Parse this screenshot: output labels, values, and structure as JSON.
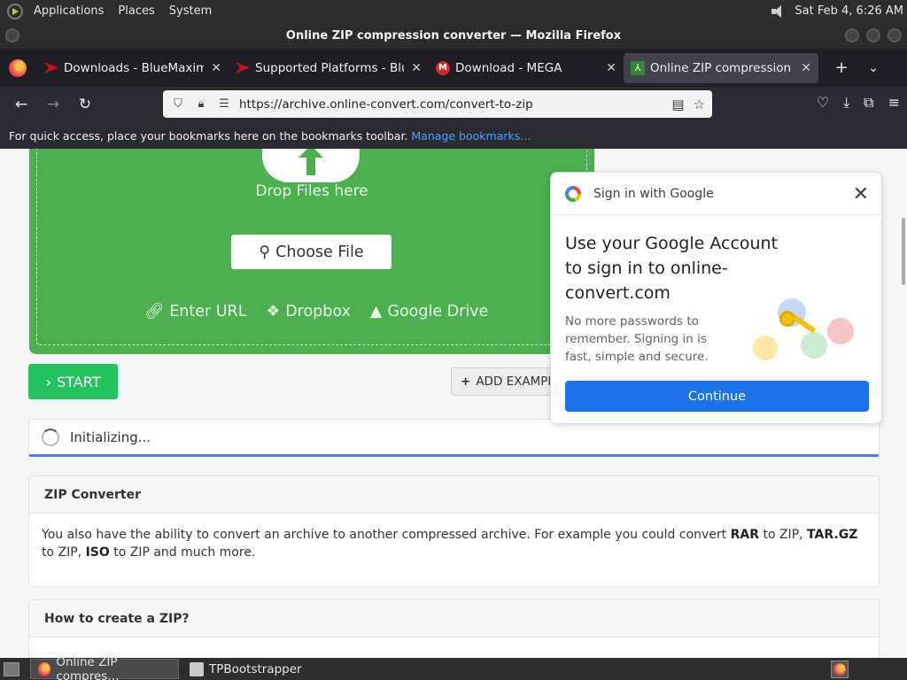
{
  "panel": {
    "menu": [
      "Applications",
      "Places",
      "System"
    ],
    "clock": "Sat Feb  4,  6:26 AM"
  },
  "window": {
    "title": "Online ZIP compression converter — Mozilla Firefox"
  },
  "tabs": [
    {
      "label": "Downloads - BlueMaxima's F",
      "icon": "flashpoint-icon",
      "active": false
    },
    {
      "label": "Supported Platforms - BlueM",
      "icon": "flashpoint-icon",
      "active": false
    },
    {
      "label": "Download - MEGA",
      "icon": "mega-icon",
      "active": false
    },
    {
      "label": "Online ZIP compression conv",
      "icon": "online-convert-icon",
      "active": true
    }
  ],
  "navbar": {
    "url": "https://archive.online-convert.com/convert-to-zip"
  },
  "bookmarks": {
    "message": "For quick access, place your bookmarks here on the bookmarks toolbar.",
    "link": "Manage bookmarks…"
  },
  "upload": {
    "drop_text": "Drop Files here",
    "choose_file": "Choose File",
    "enter_url": "Enter URL",
    "dropbox": "Dropbox",
    "google_drive": "Google Drive"
  },
  "actions": {
    "start": "START",
    "add_example": "ADD EXAMPLE FILE"
  },
  "status": {
    "text": "Initializing..."
  },
  "zip_card": {
    "title": "ZIP Converter",
    "text_1": "You also have the ability to convert an archive to another compressed archive. For example you could convert ",
    "rar": "RAR",
    "text_2": " to ZIP, ",
    "targz": "TAR.GZ",
    "text_3": " to ZIP, ",
    "iso": "ISO",
    "text_4": " to ZIP and much more."
  },
  "howto_card": {
    "title": "How to create a ZIP?"
  },
  "google_popup": {
    "header": "Sign in with Google",
    "title": "Use your Google Account to sign in to online-convert.com",
    "subtitle": "No more passwords to remember. Signing in is fast, simple and secure.",
    "continue": "Continue"
  },
  "taskbar": {
    "items": [
      {
        "label": "Online ZIP compres…",
        "active": true
      },
      {
        "label": "TPBootstrapper",
        "active": false
      }
    ]
  },
  "colors": {
    "dropzone": "#4caf50",
    "start_button": "#23c35f",
    "google_blue": "#1a73e8",
    "progress_bar": "#4a7ee0"
  }
}
